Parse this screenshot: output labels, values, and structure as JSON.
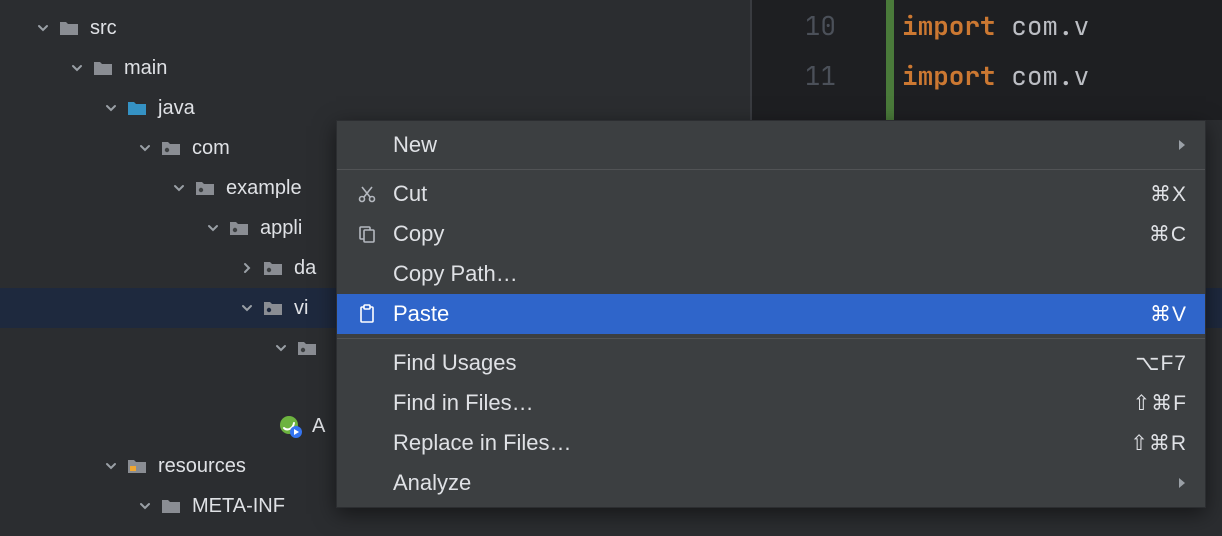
{
  "tree": {
    "src": "src",
    "main": "main",
    "java": "java",
    "com": "com",
    "example": "example",
    "application": "appli",
    "data": "da",
    "views": "vi",
    "views_child": "",
    "app_file": "A",
    "resources": "resources",
    "meta_inf": "META-INF"
  },
  "editor": {
    "ln10": "10",
    "ln11": "11",
    "kw": "import",
    "pkg10": "com.v",
    "pkg11": "com.v"
  },
  "menu": {
    "new": "New",
    "cut": {
      "label": "Cut",
      "shortcut": "⌘X"
    },
    "copy": {
      "label": "Copy",
      "shortcut": "⌘C"
    },
    "copy_path": "Copy Path…",
    "paste": {
      "label": "Paste",
      "shortcut": "⌘V"
    },
    "find_usages": {
      "label": "Find Usages",
      "shortcut": "⌥F7"
    },
    "find_in_files": {
      "label": "Find in Files…",
      "shortcut": "⇧⌘F"
    },
    "replace_in_files": {
      "label": "Replace in Files…",
      "shortcut": "⇧⌘R"
    },
    "analyze": "Analyze"
  },
  "colors": {
    "folder_grey": "#8a8d93",
    "folder_blue": "#3592c4",
    "folder_pkg": "#6e93b8",
    "chevron": "#9aa0a6"
  }
}
